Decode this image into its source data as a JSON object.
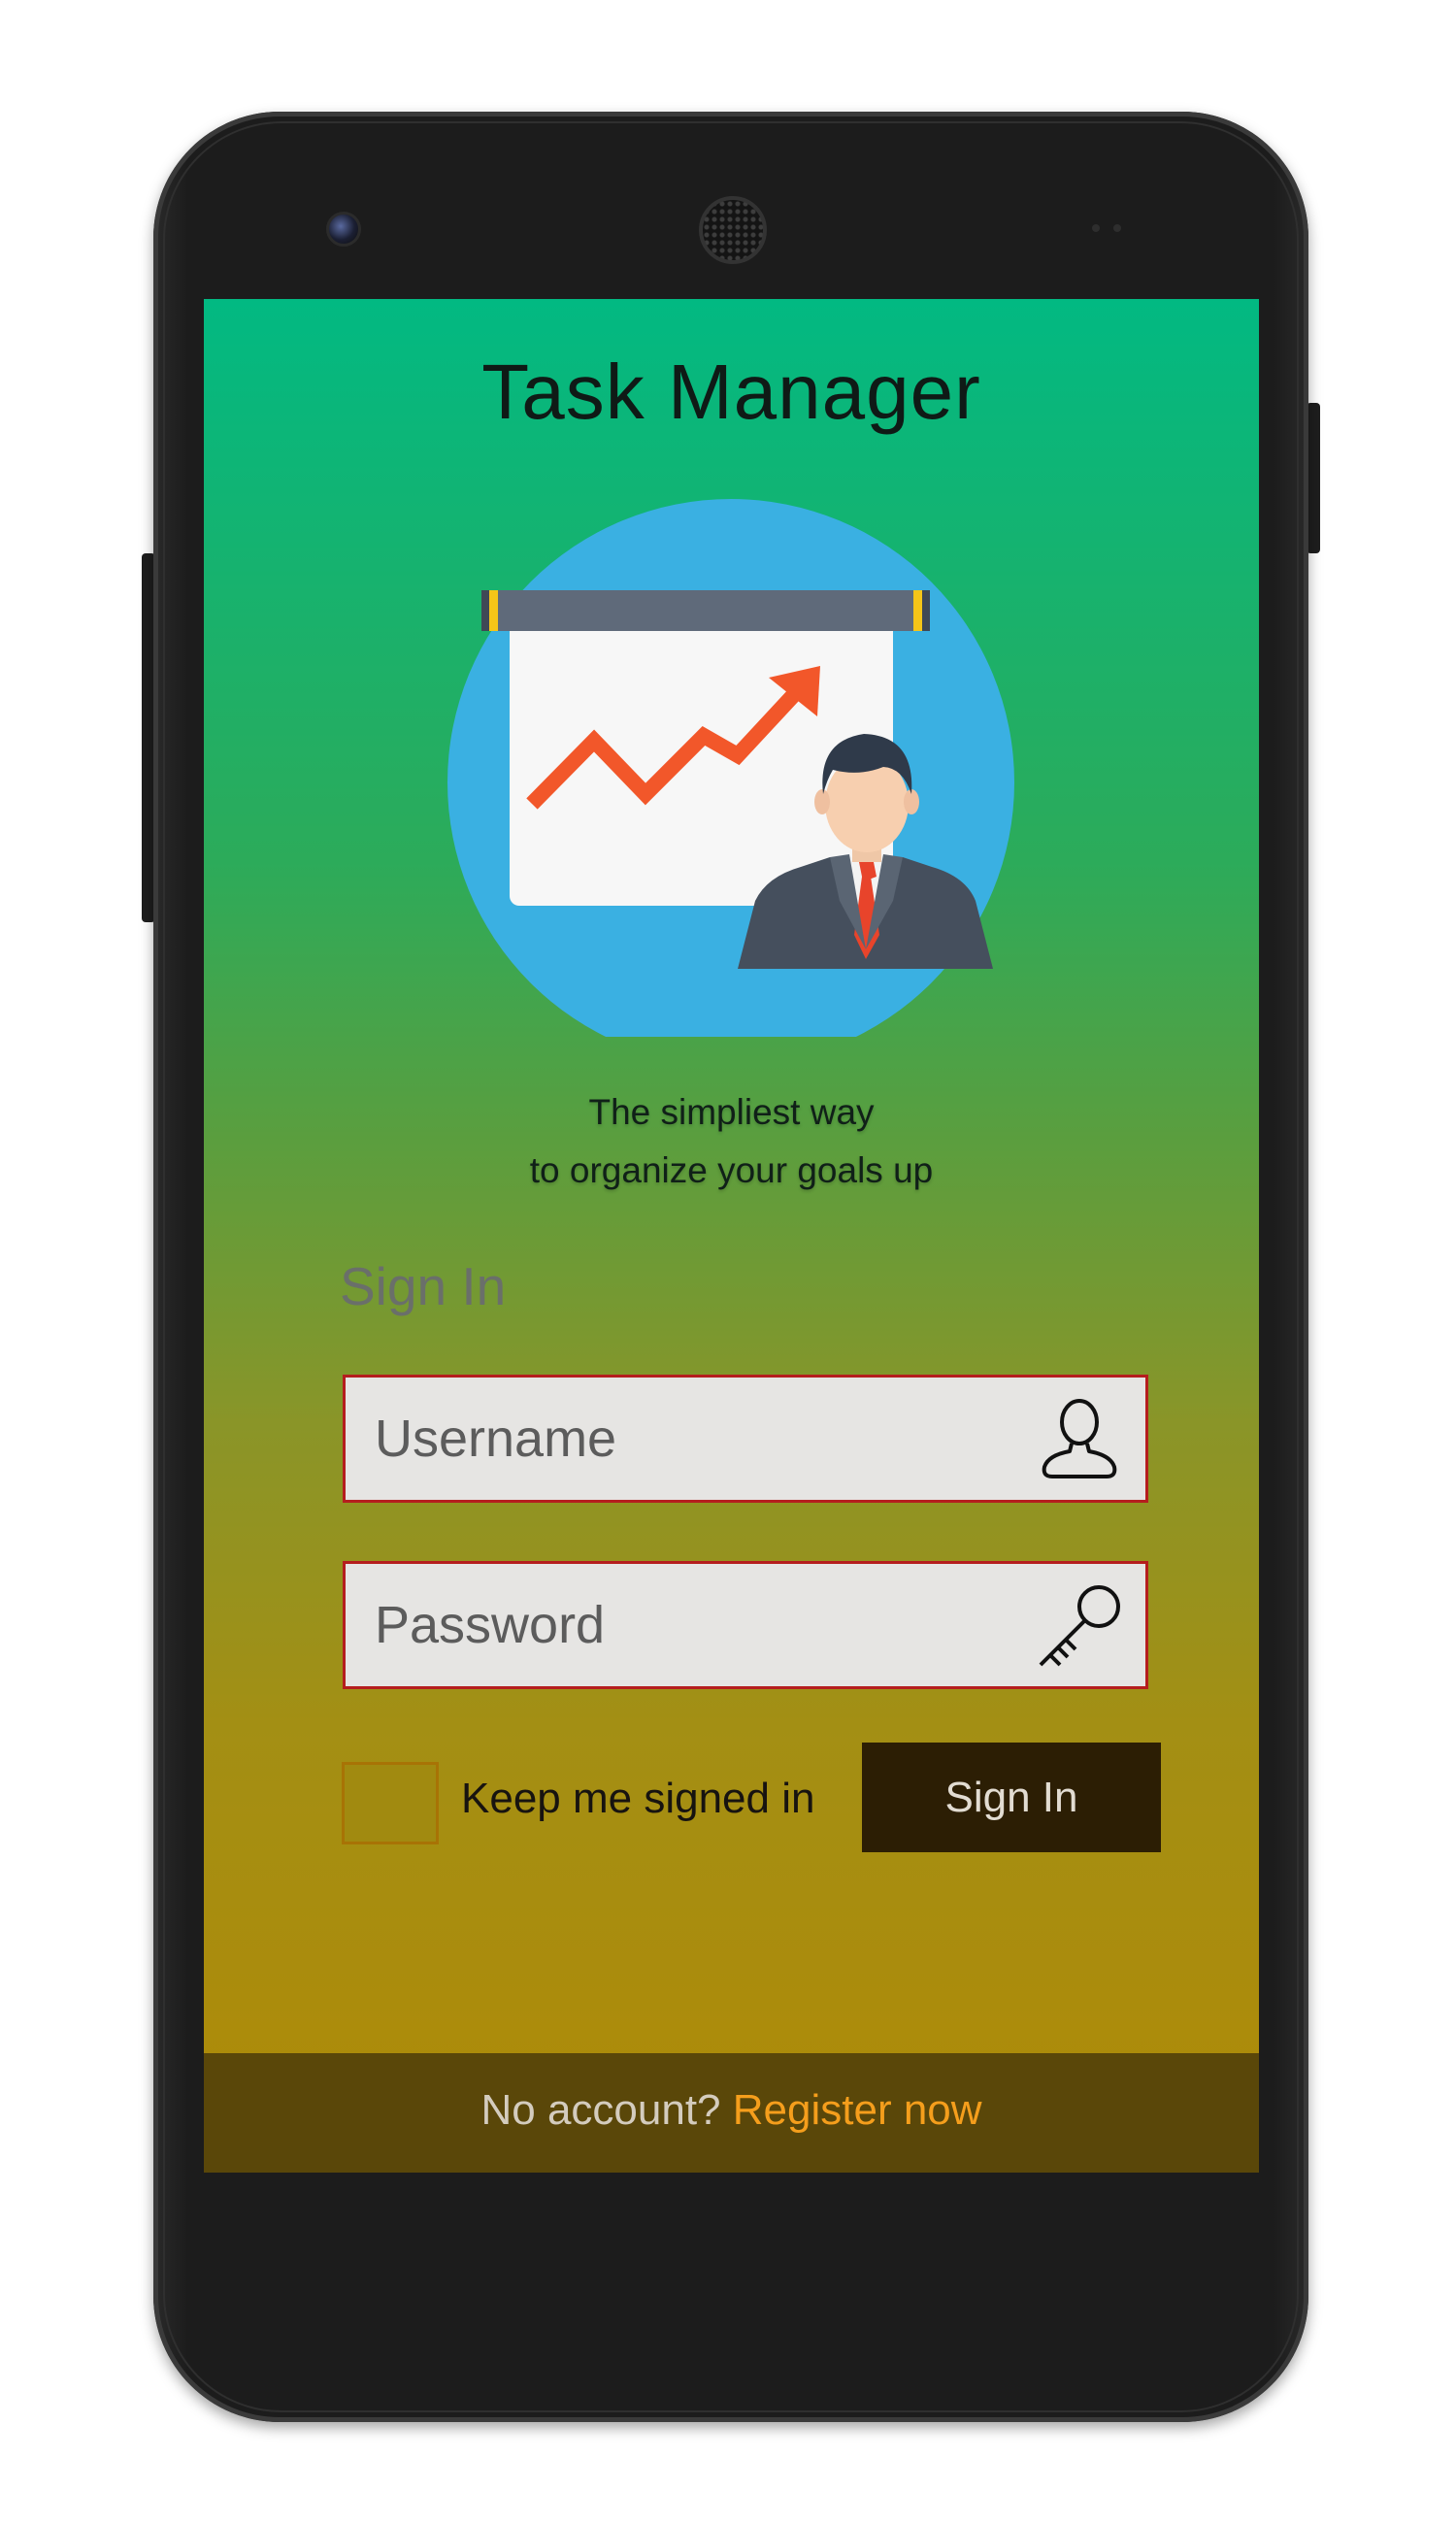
{
  "app": {
    "title": "Task Manager",
    "tagline_line1": "The simpliest way",
    "tagline_line2": "to organize your goals up"
  },
  "hero": {
    "icon": "presentation-growth-chart-with-businessman",
    "colors": {
      "circle": "#3ab0e2",
      "board": "#f7f7f7",
      "rod": "#5f6a7a",
      "arrow": "#f2572a",
      "suit": "#454f5d",
      "tie": "#e8442b"
    }
  },
  "signin": {
    "heading": "Sign In",
    "username": {
      "value": "",
      "placeholder": "Username",
      "icon": "user-icon"
    },
    "password": {
      "value": "",
      "placeholder": "Password",
      "icon": "key-icon"
    },
    "keep_signed_in": {
      "label": "Keep me signed in",
      "checked": false
    },
    "button_label": "Sign In"
  },
  "footer": {
    "question": "No account? ",
    "register_link": "Register now"
  },
  "colors": {
    "gradient_top": "#02b982",
    "gradient_bottom": "#b08a07",
    "field_border": "#b51e1e",
    "button_bg": "#2c1e04",
    "footer_bg": "#5a4709",
    "link": "#f59e1c"
  }
}
